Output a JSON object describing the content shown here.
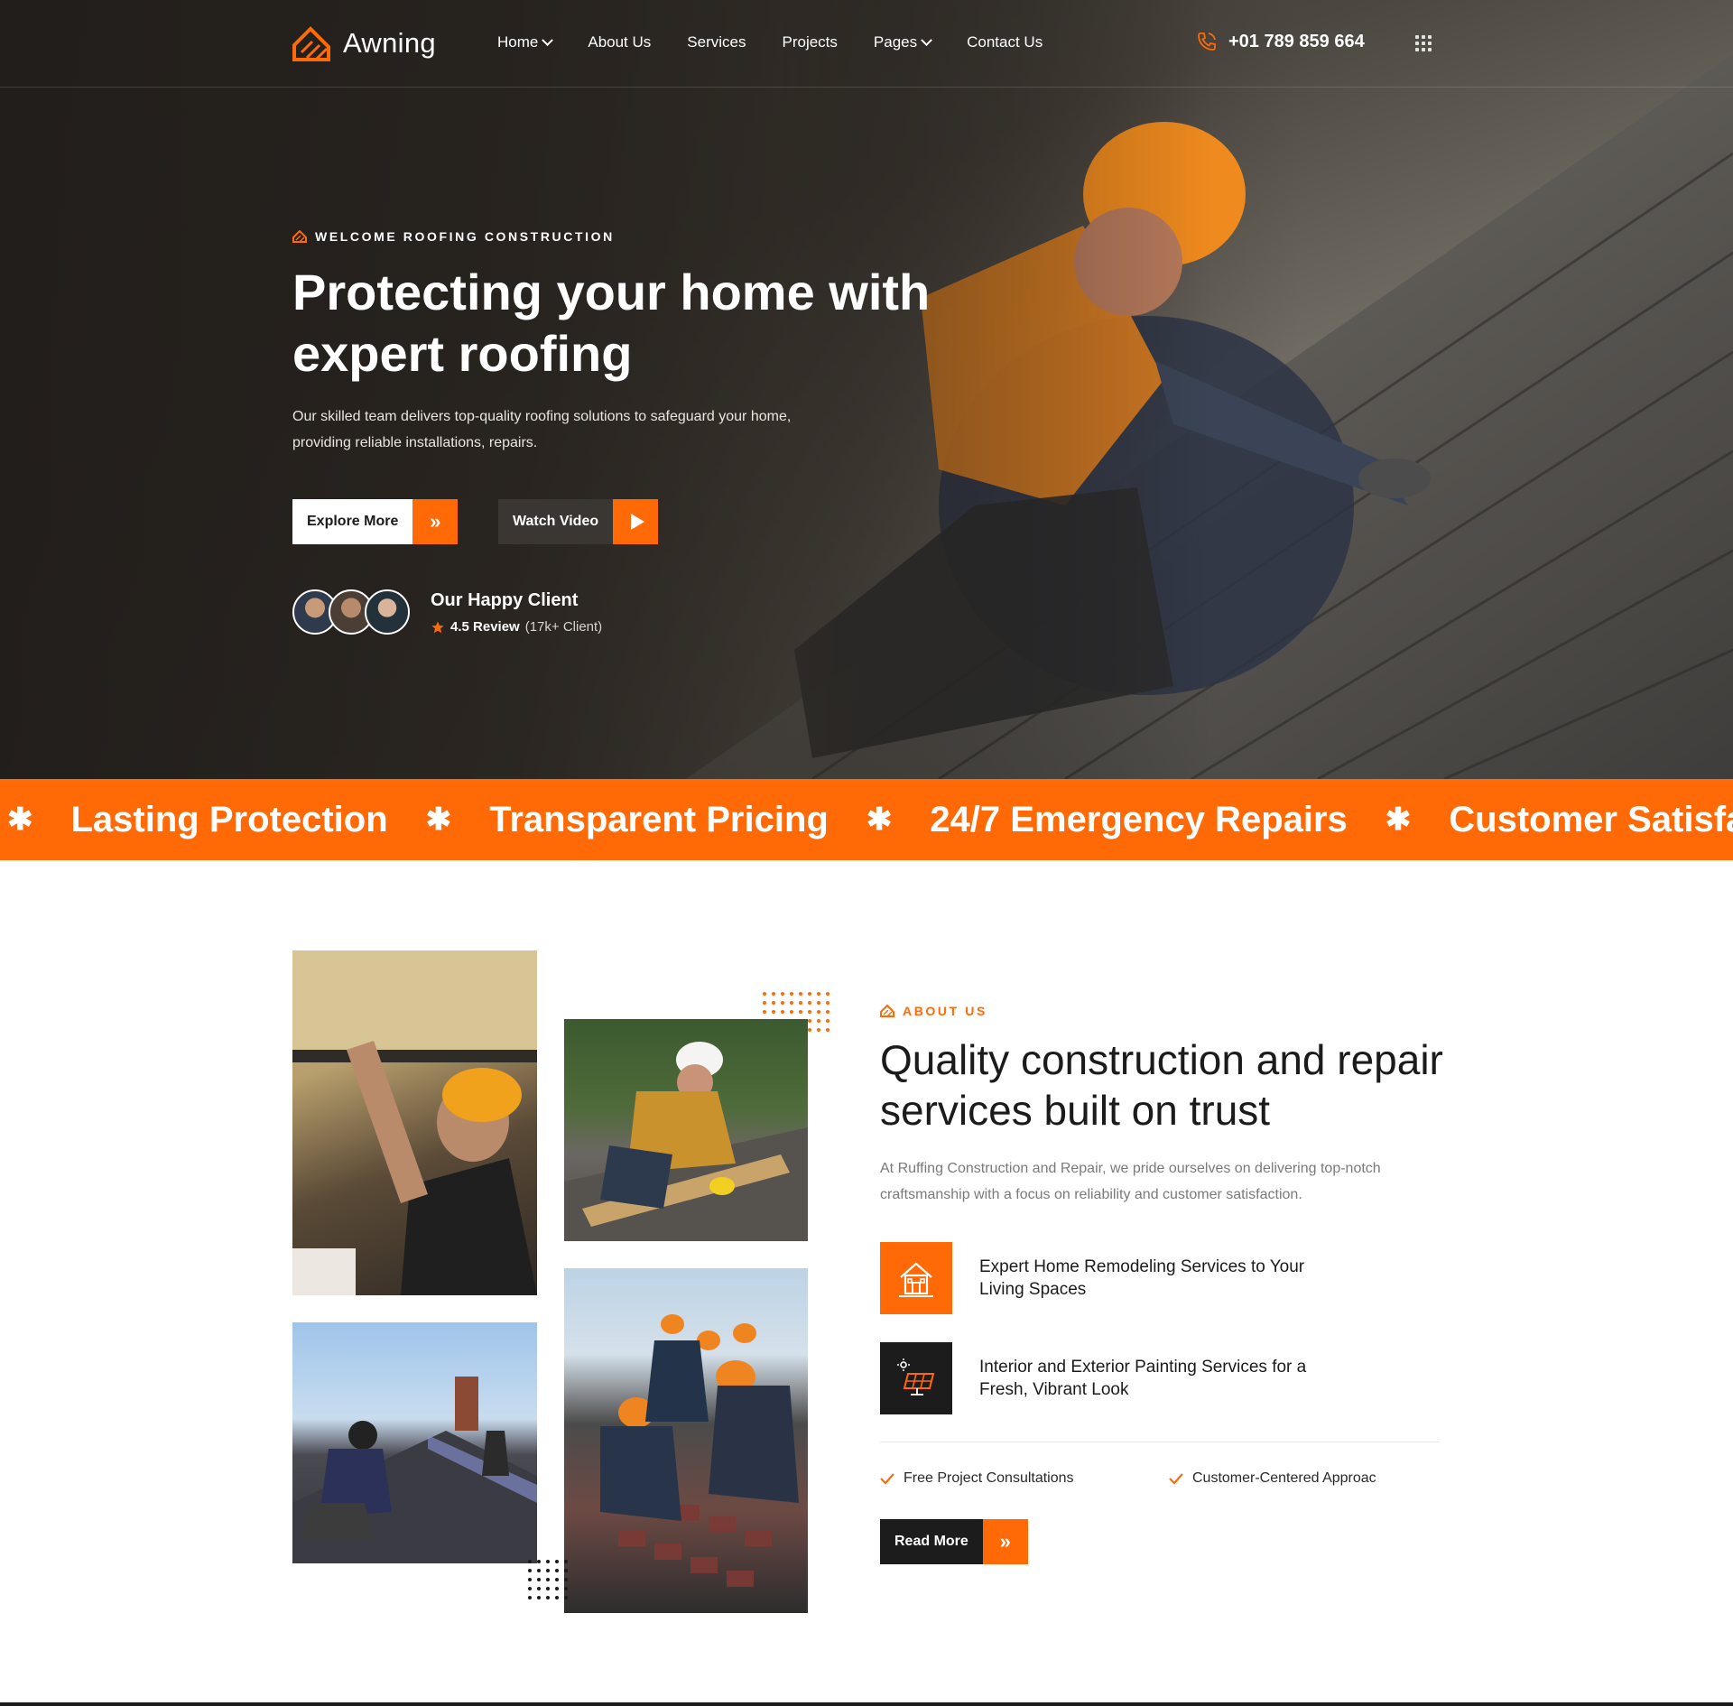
{
  "brand": {
    "name": "Awning",
    "accent": "#ff6a06",
    "dark": "#1c1c1c"
  },
  "nav": {
    "items": [
      {
        "label": "Home",
        "dropdown": true
      },
      {
        "label": "About Us",
        "dropdown": false
      },
      {
        "label": "Services",
        "dropdown": false
      },
      {
        "label": "Projects",
        "dropdown": false
      },
      {
        "label": "Pages",
        "dropdown": true
      },
      {
        "label": "Contact Us",
        "dropdown": false
      }
    ],
    "phone": "+01 789 859 664"
  },
  "hero": {
    "eyebrow": "WELCOME ROOFING CONSTRUCTION",
    "title": "Protecting your home with expert roofing",
    "description": "Our skilled team delivers top-quality roofing solutions to safeguard your home, providing reliable installations, repairs.",
    "explore_label": "Explore More",
    "watch_label": "Watch Video",
    "happy_title": "Our Happy Client",
    "review_label": "4.5 Review",
    "review_sub": "(17k+ Client)"
  },
  "ticker": {
    "items": [
      "Lasting Protection",
      "Transparent Pricing",
      "24/7 Emergency Repairs",
      "Customer Satisfac"
    ],
    "separator": "✱"
  },
  "about": {
    "eyebrow": "ABOUT US",
    "title": "Quality construction and repair services built on trust",
    "description": "At Ruffing Construction and Repair, we pride ourselves on delivering top-notch craftsmanship with a focus on reliability and customer satisfaction.",
    "features": [
      {
        "text": "Expert Home Remodeling Services to Your Living Spaces",
        "icon": "house-icon"
      },
      {
        "text": "Interior and Exterior Painting Services for a Fresh, Vibrant Look",
        "icon": "solar-panel-icon"
      }
    ],
    "checks": [
      "Free Project Consultations",
      "Customer-Centered Approac"
    ],
    "read_more_label": "Read More"
  }
}
